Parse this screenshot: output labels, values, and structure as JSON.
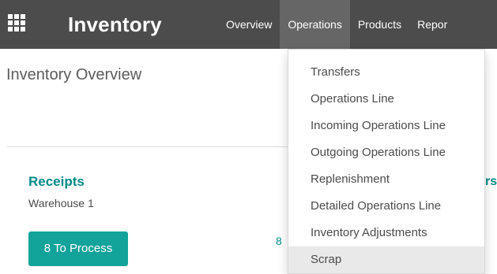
{
  "navbar": {
    "app_title": "Inventory",
    "menu": [
      "Overview",
      "Operations",
      "Products",
      "Repor"
    ]
  },
  "breadcrumb": "Inventory Overview",
  "dropdown": {
    "items": [
      "Transfers",
      "Operations Line",
      "Incoming Operations Line",
      "Outgoing Operations Line",
      "Replenishment",
      "Detailed Operations Line",
      "Inventory Adjustments",
      "Scrap"
    ],
    "selected_index": 7
  },
  "card": {
    "title": "Receipts",
    "subtitle": "Warehouse 1",
    "button": "8 To Process",
    "late_count": "8",
    "right_clip": "rs"
  },
  "icons": {
    "apps": "apps-grid-icon"
  },
  "colors": {
    "navbar_bg": "#4c4c4c",
    "navbar_active": "#666666",
    "accent": "#018a86",
    "button_bg": "#12a39a"
  }
}
